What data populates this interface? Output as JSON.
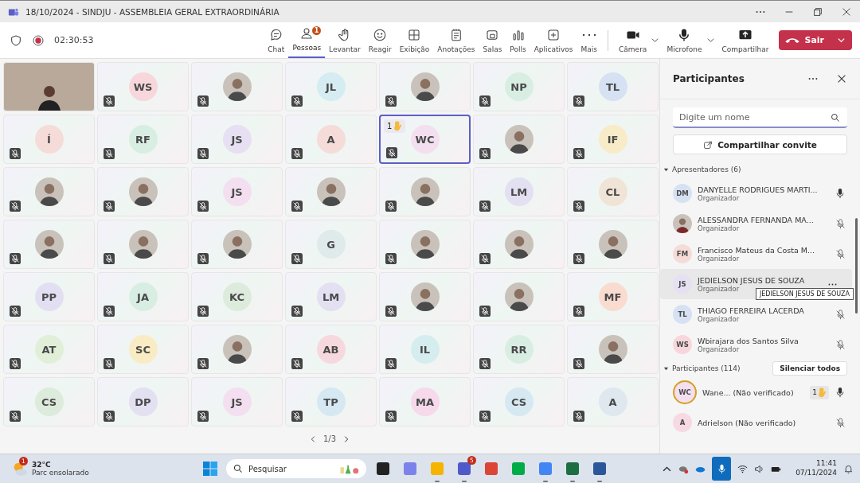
{
  "window": {
    "title": "18/10/2024 - SINDJU - ASSEMBLEIA GERAL EXTRAORDINÁRIA"
  },
  "meeting": {
    "timer": "02:30:53",
    "recording": true
  },
  "toolbar": [
    {
      "label": "Chat",
      "selected": false
    },
    {
      "label": "Pessoas",
      "selected": true,
      "badge": "1"
    },
    {
      "label": "Levantar",
      "selected": false
    },
    {
      "label": "Reagir",
      "selected": false
    },
    {
      "label": "Exibição",
      "selected": false
    },
    {
      "label": "Anotações",
      "selected": false
    },
    {
      "label": "Salas",
      "selected": false
    },
    {
      "label": "Polls",
      "selected": false
    },
    {
      "label": "Aplicativos",
      "selected": false
    },
    {
      "label": "Mais",
      "selected": false
    }
  ],
  "device_controls": [
    {
      "label": "Câmera",
      "caret": true
    },
    {
      "label": "Microfone",
      "caret": true
    },
    {
      "label": "Compartilhar",
      "caret": false
    }
  ],
  "leave_button": {
    "label": "Sair"
  },
  "tiles": [
    {
      "kind": "video",
      "muted": false,
      "highlighted": false
    },
    {
      "kind": "initials",
      "initials": "WS",
      "color": "#f7d7dc",
      "muted": true,
      "highlighted": false
    },
    {
      "kind": "photo",
      "muted": true,
      "highlighted": false
    },
    {
      "kind": "initials",
      "initials": "JL",
      "color": "#d5ecf2",
      "muted": true,
      "highlighted": false
    },
    {
      "kind": "photo",
      "muted": true,
      "highlighted": false
    },
    {
      "kind": "initials",
      "initials": "NP",
      "color": "#d9eee3",
      "muted": true,
      "highlighted": false
    },
    {
      "kind": "initials",
      "initials": "TL",
      "color": "#d6e1f3",
      "muted": true,
      "highlighted": false
    },
    {
      "kind": "initials",
      "initials": "Í",
      "color": "#f5dcd8",
      "muted": true,
      "highlighted": false
    },
    {
      "kind": "initials",
      "initials": "RF",
      "color": "#d9eee3",
      "muted": true,
      "highlighted": false
    },
    {
      "kind": "initials",
      "initials": "JS",
      "color": "#e6e0f2",
      "muted": true,
      "highlighted": false
    },
    {
      "kind": "initials",
      "initials": "A",
      "color": "#f5dcd8",
      "muted": true,
      "highlighted": false
    },
    {
      "kind": "initials",
      "initials": "WC",
      "color": "#f3dff0",
      "muted": true,
      "highlighted": true,
      "hand": "1"
    },
    {
      "kind": "photo",
      "muted": true,
      "highlighted": false
    },
    {
      "kind": "initials",
      "initials": "IF",
      "color": "#f8ebc7",
      "muted": true,
      "highlighted": false
    },
    {
      "kind": "photo",
      "muted": true,
      "highlighted": false
    },
    {
      "kind": "photo",
      "muted": true,
      "highlighted": false
    },
    {
      "kind": "initials",
      "initials": "JS",
      "color": "#f3dff0",
      "muted": true,
      "highlighted": false
    },
    {
      "kind": "photo",
      "muted": true,
      "highlighted": false
    },
    {
      "kind": "photo",
      "muted": true,
      "highlighted": false
    },
    {
      "kind": "initials",
      "initials": "LM",
      "color": "#e3e0f2",
      "muted": true,
      "highlighted": false
    },
    {
      "kind": "initials",
      "initials": "CL",
      "color": "#efe4d6",
      "muted": true,
      "highlighted": false
    },
    {
      "kind": "photo",
      "muted": true,
      "highlighted": false
    },
    {
      "kind": "photo",
      "muted": true,
      "highlighted": false
    },
    {
      "kind": "photo",
      "muted": true,
      "highlighted": false
    },
    {
      "kind": "initials",
      "initials": "G",
      "color": "#dfeaea",
      "muted": true,
      "highlighted": false
    },
    {
      "kind": "photo",
      "muted": true,
      "highlighted": false
    },
    {
      "kind": "photo",
      "muted": true,
      "highlighted": false
    },
    {
      "kind": "photo",
      "muted": true,
      "highlighted": false
    },
    {
      "kind": "initials",
      "initials": "PP",
      "color": "#e3dff3",
      "muted": true,
      "highlighted": false
    },
    {
      "kind": "initials",
      "initials": "JA",
      "color": "#d9eee3",
      "muted": true,
      "highlighted": false
    },
    {
      "kind": "initials",
      "initials": "KC",
      "color": "#dcebdc",
      "muted": true,
      "highlighted": false
    },
    {
      "kind": "initials",
      "initials": "LM",
      "color": "#e3e0f2",
      "muted": true,
      "highlighted": false
    },
    {
      "kind": "photo",
      "muted": true,
      "highlighted": false
    },
    {
      "kind": "photo",
      "muted": true,
      "highlighted": false
    },
    {
      "kind": "initials",
      "initials": "MF",
      "color": "#f9dccf",
      "muted": true,
      "highlighted": false
    },
    {
      "kind": "initials",
      "initials": "AT",
      "color": "#e1efd9",
      "muted": true,
      "highlighted": false
    },
    {
      "kind": "initials",
      "initials": "SC",
      "color": "#f9ecc4",
      "muted": true,
      "highlighted": false
    },
    {
      "kind": "photo",
      "muted": true,
      "highlighted": false
    },
    {
      "kind": "initials",
      "initials": "AB",
      "color": "#f6d9de",
      "muted": true,
      "highlighted": false
    },
    {
      "kind": "initials",
      "initials": "IL",
      "color": "#d6edf0",
      "muted": true,
      "highlighted": false
    },
    {
      "kind": "initials",
      "initials": "RR",
      "color": "#d9eee3",
      "muted": true,
      "highlighted": false
    },
    {
      "kind": "photo",
      "muted": true,
      "highlighted": false
    },
    {
      "kind": "initials",
      "initials": "CS",
      "color": "#dcebdc",
      "muted": true,
      "highlighted": false
    },
    {
      "kind": "initials",
      "initials": "DP",
      "color": "#e3e0f2",
      "muted": true,
      "highlighted": false
    },
    {
      "kind": "initials",
      "initials": "JS",
      "color": "#f3dff0",
      "muted": true,
      "highlighted": false
    },
    {
      "kind": "initials",
      "initials": "TP",
      "color": "#d6e8f2",
      "muted": true,
      "highlighted": false
    },
    {
      "kind": "initials",
      "initials": "MA",
      "color": "#f6d9ea",
      "muted": true,
      "highlighted": false
    },
    {
      "kind": "initials",
      "initials": "CS",
      "color": "#d6e8f2",
      "muted": true,
      "highlighted": false
    },
    {
      "kind": "initials",
      "initials": "A",
      "color": "#dfe8ee",
      "muted": true,
      "highlighted": false
    }
  ],
  "pagination": {
    "label": "1/3"
  },
  "panel": {
    "title": "Participantes",
    "search": {
      "placeholder": "Digite um nome"
    },
    "invite_button": "Compartilhar convite",
    "sections": [
      {
        "title": "Apresentadores (6)",
        "expanded": true,
        "people": [
          {
            "initials": "DM",
            "color": "#d6e1f3",
            "photo": false,
            "name": "DANYELLE RODRIGUES MARTI...",
            "role": "Organizador",
            "muted": false,
            "hovered": false
          },
          {
            "photo": true,
            "name": "ALESSANDRA FERNANDA MA...",
            "role": "Organizador",
            "muted": true,
            "hovered": false
          },
          {
            "initials": "FM",
            "color": "#f5dcd8",
            "photo": false,
            "name": "Francisco Mateus da Costa M...",
            "role": "Organizador",
            "muted": true,
            "hovered": false
          },
          {
            "initials": "JS",
            "color": "#e6e0f2",
            "photo": false,
            "name": "JEDIELSON JESUS DE SOUZA",
            "role": "Organizador",
            "hovered": true,
            "tooltip": "JEDIELSON JESUS DE SOUZA"
          },
          {
            "initials": "TL",
            "color": "#d6e1f3",
            "photo": false,
            "name": "THIAGO FERREIRA LACERDA",
            "role": "Organizador",
            "muted": true,
            "hovered": false
          },
          {
            "initials": "WS",
            "color": "#f7d7dc",
            "photo": false,
            "name": "Wbirajara dos Santos Silva",
            "role": "Organizador",
            "muted": true,
            "hovered": false
          }
        ]
      },
      {
        "title": "Participantes (114)",
        "expanded": true,
        "action": "Silenciar todos",
        "people": [
          {
            "initials": "WC",
            "color": "#f3dff0",
            "photo": false,
            "name": "Wane... (Não verificado)",
            "muted": false,
            "hovered": false,
            "hand": "1"
          },
          {
            "initials": "A",
            "color": "#f6d9e3",
            "photo": false,
            "name": "Adrielson (Não verificado)",
            "muted": true,
            "hovered": false
          }
        ]
      }
    ]
  },
  "taskbar": {
    "weather": {
      "badge": "1",
      "temperature": "32°C",
      "condition": "Parc ensolarado"
    },
    "search": {
      "placeholder": "Pesquisar"
    },
    "apps": [
      {
        "open": false
      },
      {
        "open": false
      },
      {
        "open": true
      },
      {
        "open": true,
        "badge": "5"
      },
      {
        "open": false
      },
      {
        "open": false
      },
      {
        "open": true
      },
      {
        "open": true
      },
      {
        "open": true
      }
    ],
    "clock": {
      "time": "11:41",
      "date": "07/11/2024"
    }
  }
}
